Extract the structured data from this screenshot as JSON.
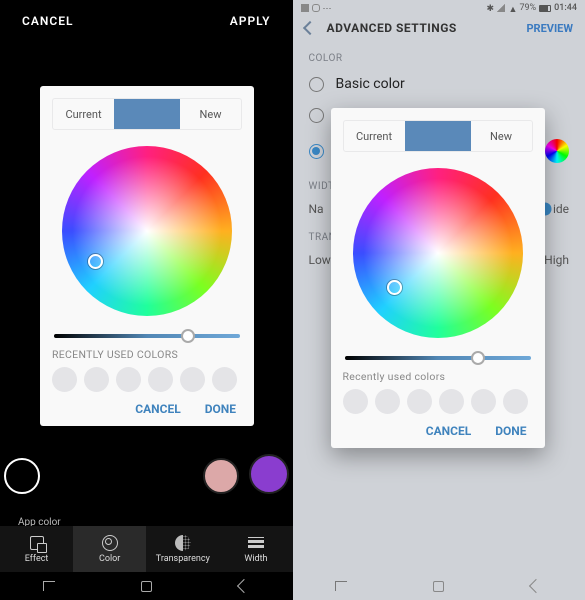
{
  "left": {
    "topbar": {
      "cancel": "CANCEL",
      "apply": "APPLY"
    },
    "app_label": "App color",
    "bottom_tabs": {
      "effect": "Effect",
      "color": "Color",
      "transparency": "Transparency",
      "width": "Width"
    }
  },
  "right": {
    "status": {
      "battery": "79%",
      "time": "01:44"
    },
    "titlebar": {
      "title": "ADVANCED SETTINGS",
      "preview": "PREVIEW"
    },
    "sections": {
      "color": "COLOR",
      "width": "WIDT",
      "transparency": "TRAN"
    },
    "basic_color": "Basic color",
    "width_row": {
      "min": "Na",
      "max": "ide"
    },
    "transp_row": {
      "min": "Low",
      "max": "High"
    }
  },
  "picker": {
    "current_label": "Current",
    "new_label": "New",
    "swatch_color": "#5a89b9",
    "grad_thumb_pct": 72,
    "recent_label_upper": "RECENTLY USED COLORS",
    "recent_label_lower": "Recently used colors",
    "actions": {
      "cancel": "CANCEL",
      "done": "DONE"
    }
  }
}
